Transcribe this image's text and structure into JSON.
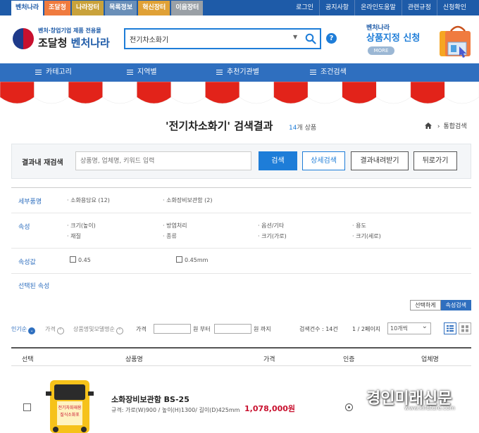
{
  "topbar": {
    "tabs": [
      "벤처나라",
      "조달청",
      "나라장터",
      "목록정보",
      "혁신장터",
      "이음장터"
    ],
    "links": [
      "로그인",
      "공지사항",
      "온라인도움말",
      "관련규정",
      "신청확인"
    ]
  },
  "header": {
    "logo_sub": "벤처·창업기업 제품 전용몰",
    "logo_main_a": "조달청",
    "logo_main_b": "벤처나라",
    "search_value": "전기차소화기",
    "help": "?",
    "promo_small": "벤처나라",
    "promo_big": "상품지정 신청",
    "promo_more": "MORE"
  },
  "nav": {
    "items": [
      "카테고리",
      "지역별",
      "추천기관별",
      "조건검색"
    ]
  },
  "result": {
    "title": "'전기차소화기' 검색결과",
    "count_num": "14",
    "count_unit": "개 상품",
    "breadcrumb": "통합검색"
  },
  "refine": {
    "label": "결과내 재검색",
    "placeholder": "상품명, 업체명, 키워드 입력",
    "search": "검색",
    "detail": "상세검색",
    "download": "결과내려받기",
    "back": "뒤로가기"
  },
  "facets": {
    "category_label": "세부품명",
    "categories": [
      "소화용담요 (12)",
      "소화장비보관함 (2)"
    ],
    "attr_label": "속성",
    "attrs": [
      "크기(높이)",
      "방염처리",
      "옵션/기타",
      "용도",
      "재질",
      "종류",
      "크기(가로)",
      "크기(세로)"
    ],
    "value_label": "속성값",
    "values": [
      "0.45",
      "0.45mm"
    ],
    "selected_label": "선택된 속성"
  },
  "toggles": {
    "select_close": "선택하게",
    "attr_search": "속성검색"
  },
  "sortbar": {
    "popular": "인기순",
    "price": "가격",
    "name": "상품명및모델명순",
    "price_label": "가격",
    "from": "원 부터",
    "to": "원 까지",
    "total": "검색건수 : 14건",
    "paging": "1 / 2페이지",
    "perpage": "10개씩"
  },
  "table": {
    "headers": [
      "선택",
      "상품명",
      "가격",
      "인증",
      "업체명"
    ]
  },
  "product": {
    "name": "소화장비보관함 BS-25",
    "spec": "규격: 가로(W)900 / 높이(H)1300/ 길이(D)425mm",
    "price": "1,078,000원",
    "image_text_1": "전기차화재용",
    "image_text_2": "질식소화포"
  },
  "watermark": {
    "big": "경인미래신문",
    "small": "www.kifuture.com"
  },
  "colors": {
    "brand_blue": "#1e5ba8",
    "accent_blue": "#1e7dd8",
    "nav_blue": "#2f6fbf",
    "price_red": "#c8102e",
    "awning_red": "#e2231a"
  }
}
